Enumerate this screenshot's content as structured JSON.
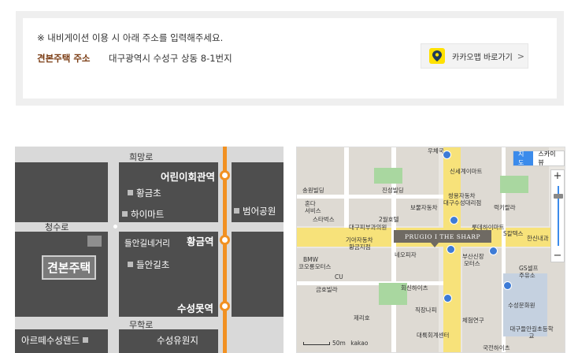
{
  "notice": "※ 내비게이션 이용 시 아래 주소를 입력해주세요.",
  "address": {
    "label": "견본주택 주소",
    "value": "대구광역시 수성구 상동 8-1번지"
  },
  "kakao_button": {
    "label": "카카오맵 바로가기",
    "chevron": ">"
  },
  "schematic": {
    "roads": {
      "top": "희망로",
      "left": "청수로",
      "bottom": "무학로"
    },
    "stations": [
      "어린이회관역",
      "황금역",
      "수성못역"
    ],
    "landmarks": [
      "황금초",
      "하이마트",
      "범어공원",
      "들안길네거리",
      "들안길초",
      "아르떼수성랜드",
      "수성유원지"
    ],
    "home_label": "견본주택"
  },
  "kakaomap": {
    "map_types": [
      "지도",
      "스카이뷰"
    ],
    "banner": "PRUGIO  I  THE SHARP",
    "scale": "50m",
    "logo": "kakao",
    "zoom_in": "+",
    "zoom_out": "−",
    "pois": [
      "우체국",
      "신세계이마트",
      "송원빌딩",
      "진성빌딩",
      "쌍용자동차",
      "대구수성대리점",
      "혼다",
      "서비스",
      "보물자동차",
      "럭키랄라",
      "스타벅스",
      "2월호텔",
      "롯데하이마트",
      "대구피부과의원",
      "기아자동차",
      "황금지점",
      "S칼텍스",
      "한신내과",
      "BMW",
      "코오롱모터스",
      "네오피자",
      "부산신장",
      "모터스",
      "GS셀프",
      "주유소",
      "CU",
      "금호빌라",
      "회신하이츠",
      "수성문화원",
      "제리호",
      "직장나피",
      "체험연구",
      "대륙회계센터",
      "대구들안길초등학교",
      "국전하이츠"
    ]
  }
}
